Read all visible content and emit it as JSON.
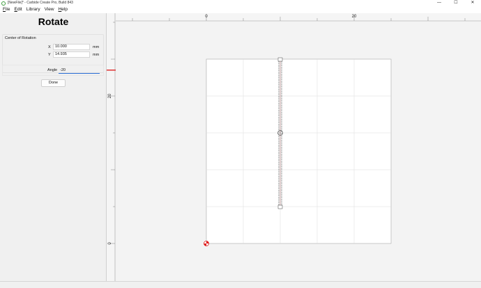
{
  "window": {
    "title": "[NewFile]* - Carbide Create Pro, Build 843",
    "minimize": "—",
    "maximize": "☐",
    "close": "✕"
  },
  "menu": [
    {
      "label": "File",
      "accel": "F",
      "rest": "ile"
    },
    {
      "label": "Edit",
      "accel": "E",
      "rest": "dit"
    },
    {
      "label": "Library",
      "accel": "",
      "rest": "Library"
    },
    {
      "label": "View",
      "accel": "",
      "rest": "View"
    },
    {
      "label": "Help",
      "accel": "H",
      "rest": "elp"
    }
  ],
  "panel": {
    "title": "Rotate",
    "center_group_label": "Center of Rotation",
    "x_label": "X",
    "x_value": "10.000",
    "y_label": "Y",
    "y_value": "14.935",
    "unit": "mm",
    "angle_label": "Angle",
    "angle_value": "-20",
    "done_label": "Done"
  },
  "rulers": {
    "top_labels": [
      "0",
      "20"
    ],
    "left_labels": [
      "20",
      "0"
    ]
  },
  "colors": {
    "accent": "#2a6fd6",
    "ruler_marker": "#e03030",
    "origin_marker": "#e02020",
    "grid": "#d9d9d9"
  }
}
